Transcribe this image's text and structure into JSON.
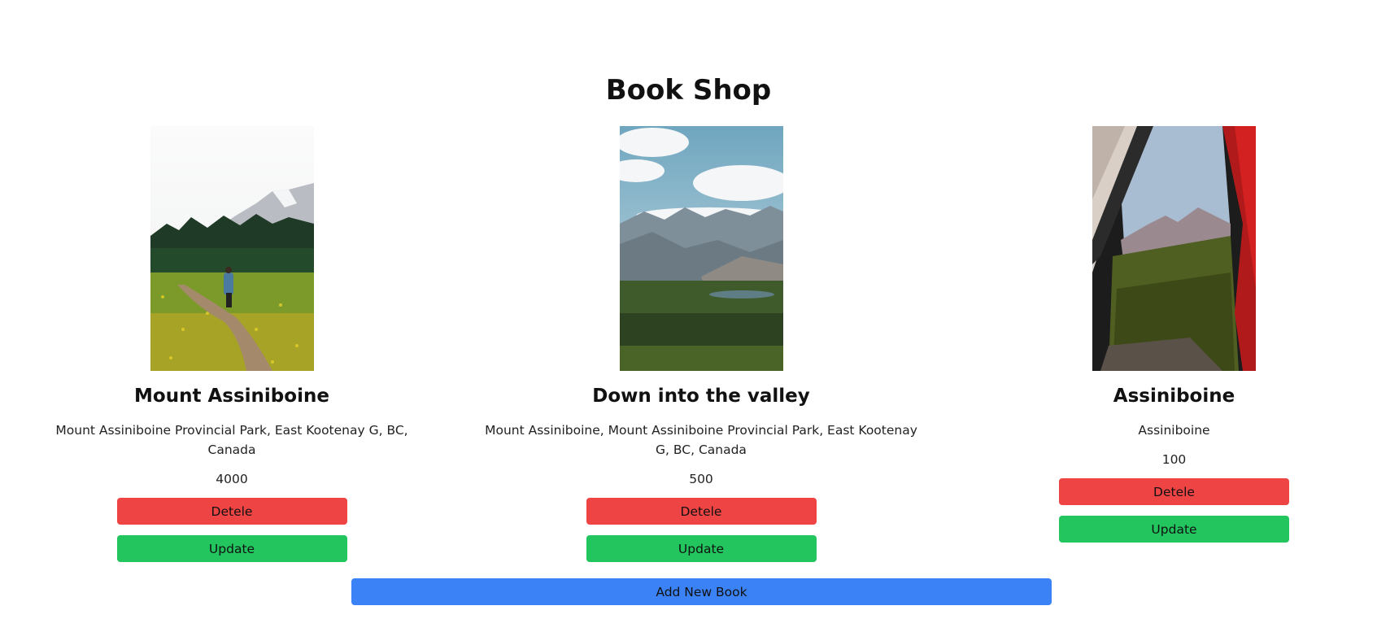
{
  "page": {
    "title": "Book Shop"
  },
  "books": [
    {
      "title": "Mount Assiniboine",
      "description": "Mount Assiniboine Provincial Park, East Kootenay G, BC, Canada",
      "price": "4000",
      "delete_label": "Detele",
      "update_label": "Update"
    },
    {
      "title": "Down into the valley",
      "description": "Mount Assiniboine, Mount Assiniboine Provincial Park, East Kootenay G, BC, Canada",
      "price": "500",
      "delete_label": "Detele",
      "update_label": "Update"
    },
    {
      "title": "Assiniboine",
      "description": "Assiniboine",
      "price": "100",
      "delete_label": "Detele",
      "update_label": "Update"
    }
  ],
  "add_button_label": "Add New Book",
  "colors": {
    "delete": "#ef4444",
    "update": "#22c55e",
    "add": "#3b82f6"
  }
}
